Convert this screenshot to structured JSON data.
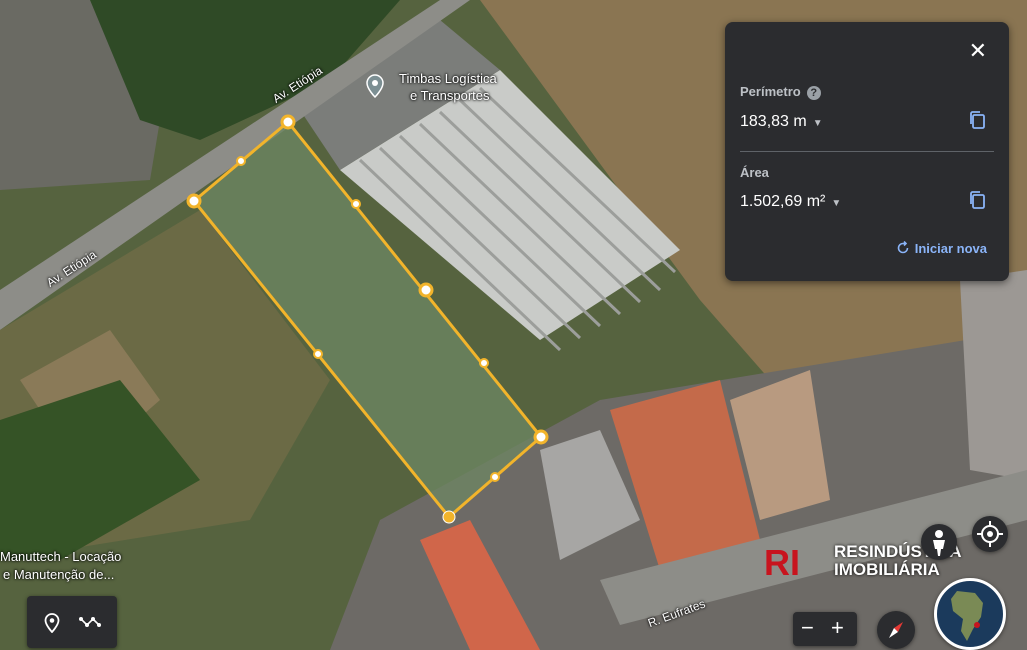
{
  "map": {
    "place_label_line1": "Timbas Logística",
    "place_label_line2": "e Transportes",
    "road_labels": [
      "Av. Etiópia",
      "Av. Etiópia",
      "R. Eufrates"
    ],
    "business_label_line1": "Manuttech - Locação",
    "business_label_line2": "e Manutenção de...",
    "polygon_color": "#f2b42b"
  },
  "measure_panel": {
    "perimeter_label": "Perímetro",
    "perimeter_value": "183,83 m",
    "area_label": "Área",
    "area_value": "1.502,69 m²",
    "restart_label": "Iniciar nova",
    "accent_color": "#8ab4f8"
  },
  "brand": {
    "line1": "RESINDÚSTRIA",
    "line2": "IMOBILIÁRIA",
    "logo_text": "RI",
    "logo_color": "#c8141e"
  },
  "controls": {
    "icons": [
      "pin-icon",
      "measure-path-icon",
      "zoom-out-icon",
      "zoom-in-icon",
      "compass-icon",
      "pegman-icon",
      "my-location-icon",
      "globe-icon"
    ],
    "zoom_out": "−",
    "zoom_in": "+"
  }
}
